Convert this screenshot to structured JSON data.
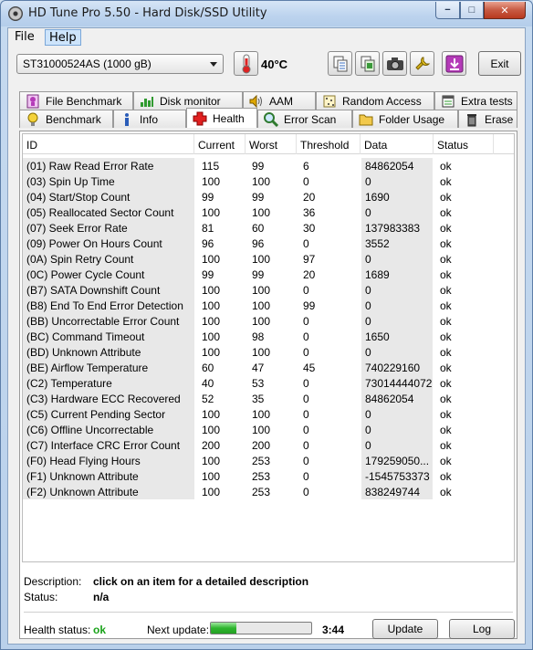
{
  "window": {
    "title": "HD Tune Pro 5.50 - Hard Disk/SSD Utility",
    "min_glyph": "−",
    "max_glyph": "□",
    "close_glyph": "✕"
  },
  "menu": {
    "file": "File",
    "help": "Help"
  },
  "toolbar": {
    "drive": "ST31000524AS (1000 gB)",
    "temperature": "40°C",
    "exit": "Exit",
    "icons": [
      "copy-icon",
      "copy-screen-icon",
      "camera-icon",
      "options-icon",
      "save-download-icon"
    ]
  },
  "tabs_top": [
    {
      "label": "File Benchmark",
      "icon": "file-benchmark-icon"
    },
    {
      "label": "Disk monitor",
      "icon": "disk-monitor-icon"
    },
    {
      "label": "AAM",
      "icon": "speaker-icon"
    },
    {
      "label": "Random Access",
      "icon": "random-access-icon"
    },
    {
      "label": "Extra tests",
      "icon": "extra-tests-icon"
    }
  ],
  "tabs_bottom": [
    {
      "label": "Benchmark",
      "icon": "lightbulb-icon"
    },
    {
      "label": "Info",
      "icon": "info-icon"
    },
    {
      "label": "Health",
      "icon": "health-cross-icon"
    },
    {
      "label": "Error Scan",
      "icon": "magnifier-icon"
    },
    {
      "label": "Folder Usage",
      "icon": "folder-icon"
    },
    {
      "label": "Erase",
      "icon": "trash-icon"
    }
  ],
  "table": {
    "columns": [
      "ID",
      "Current",
      "Worst",
      "Threshold",
      "Data",
      "Status"
    ],
    "rows": [
      [
        "(01) Raw Read Error Rate",
        "115",
        "99",
        "6",
        "84862054",
        "ok"
      ],
      [
        "(03) Spin Up Time",
        "100",
        "100",
        "0",
        "0",
        "ok"
      ],
      [
        "(04) Start/Stop Count",
        "99",
        "99",
        "20",
        "1690",
        "ok"
      ],
      [
        "(05) Reallocated Sector Count",
        "100",
        "100",
        "36",
        "0",
        "ok"
      ],
      [
        "(07) Seek Error Rate",
        "81",
        "60",
        "30",
        "137983383",
        "ok"
      ],
      [
        "(09) Power On Hours Count",
        "96",
        "96",
        "0",
        "3552",
        "ok"
      ],
      [
        "(0A) Spin Retry Count",
        "100",
        "100",
        "97",
        "0",
        "ok"
      ],
      [
        "(0C) Power Cycle Count",
        "99",
        "99",
        "20",
        "1689",
        "ok"
      ],
      [
        "(B7) SATA Downshift Count",
        "100",
        "100",
        "0",
        "0",
        "ok"
      ],
      [
        "(B8) End To End Error Detection",
        "100",
        "100",
        "99",
        "0",
        "ok"
      ],
      [
        "(BB) Uncorrectable Error Count",
        "100",
        "100",
        "0",
        "0",
        "ok"
      ],
      [
        "(BC) Command Timeout",
        "100",
        "98",
        "0",
        "1650",
        "ok"
      ],
      [
        "(BD) Unknown Attribute",
        "100",
        "100",
        "0",
        "0",
        "ok"
      ],
      [
        "(BE) Airflow Temperature",
        "60",
        "47",
        "45",
        "740229160",
        "ok"
      ],
      [
        "(C2) Temperature",
        "40",
        "53",
        "0",
        "73014444072",
        "ok"
      ],
      [
        "(C3) Hardware ECC Recovered",
        "52",
        "35",
        "0",
        "84862054",
        "ok"
      ],
      [
        "(C5) Current Pending Sector",
        "100",
        "100",
        "0",
        "0",
        "ok"
      ],
      [
        "(C6) Offline Uncorrectable",
        "100",
        "100",
        "0",
        "0",
        "ok"
      ],
      [
        "(C7) Interface CRC Error Count",
        "200",
        "200",
        "0",
        "0",
        "ok"
      ],
      [
        "(F0) Head Flying Hours",
        "100",
        "253",
        "0",
        "179259050...",
        "ok"
      ],
      [
        "(F1) Unknown Attribute",
        "100",
        "253",
        "0",
        "-1545753373",
        "ok"
      ],
      [
        "(F2) Unknown Attribute",
        "100",
        "253",
        "0",
        "838249744",
        "ok"
      ]
    ]
  },
  "description": {
    "label": "Description:",
    "value": "click on an item for a detailed description",
    "status_label": "Status:",
    "status_value": "n/a"
  },
  "footer": {
    "health_label": "Health status:",
    "health_value": "ok",
    "health_color": "#1aa31a",
    "next_update_label": "Next update:",
    "progress_fraction": 0.25,
    "time": "3:44",
    "update_button": "Update",
    "log_button": "Log"
  }
}
